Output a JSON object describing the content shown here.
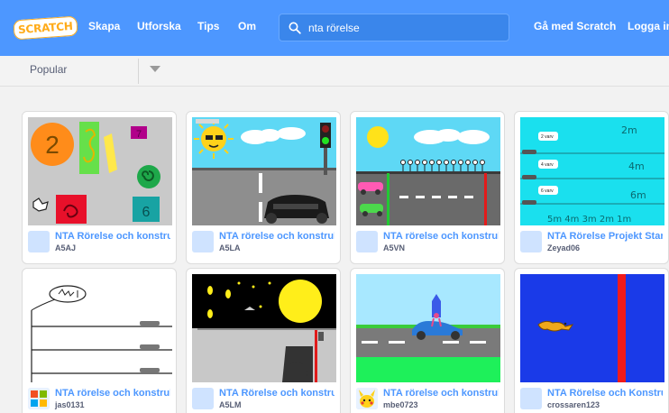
{
  "nav": {
    "logo": "SCRATCH",
    "links": [
      "Skapa",
      "Utforska",
      "Tips",
      "Om"
    ],
    "search_value": "nta rörelse",
    "join": "Gå med Scratch",
    "login": "Logga in"
  },
  "filter": {
    "selected": "Popular"
  },
  "colors": {
    "nav": "#4d97ff",
    "link": "#4d97ff",
    "author": "#575e75",
    "logo": "#ffab19"
  },
  "projects": [
    {
      "title": "NTA Rörelse och konstruktion",
      "author": "A5AJ"
    },
    {
      "title": "NTA rörelse och konstruktion",
      "author": "A5LA"
    },
    {
      "title": "NTA rörelse och konstruktion",
      "author": "A5VN"
    },
    {
      "title": "NTA Rörelse Projekt Start",
      "author": "Zeyad06"
    },
    {
      "title": "NTA rörelse och konstruktion",
      "author": "jas0131"
    },
    {
      "title": "NTA Rörelse och konstruktion",
      "author": "A5LM"
    },
    {
      "title": "NTA rörelse och konstruktion",
      "author": "mbe0723"
    },
    {
      "title": "NTA Rörelse och Konstruktion",
      "author": "crossaren123"
    }
  ],
  "thumb_text": {
    "p1": [
      "2",
      "7",
      "6"
    ],
    "p4_labels": [
      "2 varv",
      "4 varv",
      "6 varv"
    ],
    "p4_marks": [
      "2m",
      "4m",
      "6m"
    ],
    "p4_bottom": "5m 4m 3m 2m 1m"
  }
}
